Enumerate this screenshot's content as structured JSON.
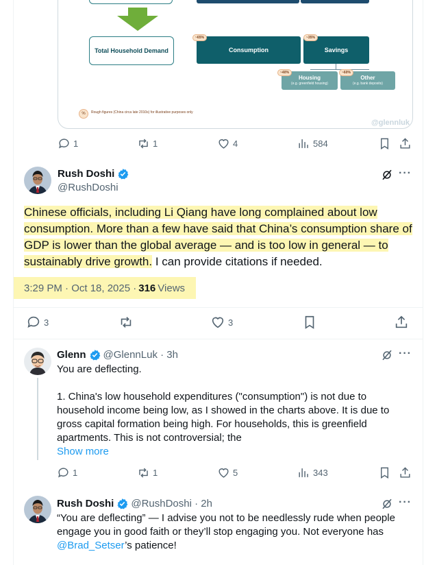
{
  "diagram": {
    "total_household_demand": "Total Household Demand",
    "consumption": "Consumption",
    "savings": "Savings",
    "consumption_pct": "~65%",
    "savings_pct": "~35%",
    "housing": "Housing",
    "housing_sub": "(e.g. greenfield housing)",
    "housing_pct": "~40%",
    "other": "Other",
    "other_sub": "(e.g. bank deposits)",
    "other_pct": "~60%",
    "footnote_symbol": "%",
    "footnote": "Rough figures (China circa late 2010s) for illustrative purposes only",
    "watermark": "@glennluk"
  },
  "post0_actions": {
    "replies": "1",
    "reposts": "1",
    "likes": "4",
    "views": "584"
  },
  "main_post": {
    "name": "Rush Doshi",
    "handle": "@RushDoshi",
    "text_highlighted": "Chinese officials, including Li Qiang have long complained about low consumption. More than a few have said that China’s consumption share of GDP is lower than the global average — and is too low in general — to sustainably drive growth.",
    "text_rest": " I can provide citations if needed.",
    "time": "3:29 PM · Oct 18, 2025 · ",
    "views_count": "316",
    "views_label": "Views",
    "actions": {
      "replies": "3",
      "reposts": "",
      "likes": "3"
    }
  },
  "reply1": {
    "name": "Glenn",
    "handle": "@GlennLuk · 3h",
    "line1": "You are deflecting.",
    "line2": "1. China's low household expenditures (\"consumption\") is not due to household income being low, as I showed in the charts above. It is due to gross capital formation being high. For households, this is greenfield apartments. This is not controversial; the",
    "show_more": "Show more",
    "actions": {
      "replies": "1",
      "reposts": "1",
      "likes": "5",
      "views": "343"
    }
  },
  "reply2": {
    "name": "Rush Doshi",
    "handle": "@RushDoshi · 2h",
    "text_before": "“You are deflecting” — I advise you not to be needlessly rude when people engage you in good faith or they’ll stop engaging you. Not everyone has ",
    "mention": "@Brad_Setser",
    "text_after": "’s patience!"
  },
  "colors": {
    "accent": "#1d9bf0",
    "highlight": "#fdf6b3",
    "navy": "#1e4c6e",
    "teal": "#0f5f6a"
  }
}
